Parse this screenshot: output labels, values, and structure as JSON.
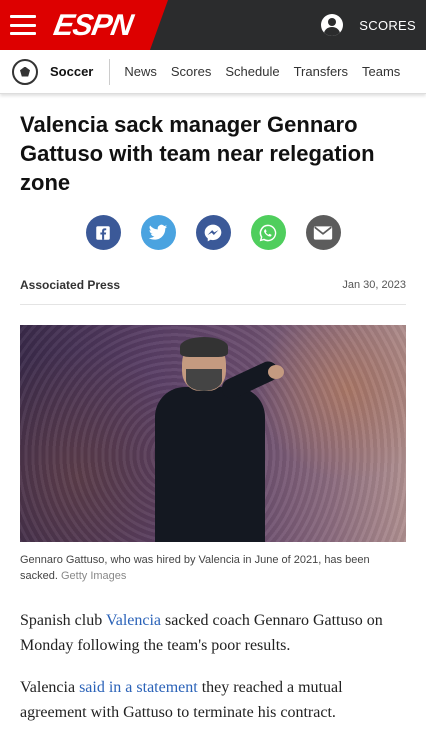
{
  "header": {
    "brand": "ESPN",
    "scores_label": "SCORES"
  },
  "subnav": {
    "sport": "Soccer",
    "items": [
      "News",
      "Scores",
      "Schedule",
      "Transfers",
      "Teams"
    ]
  },
  "article": {
    "title": "Valencia sack manager Gennaro Gattuso with team near relegation zone",
    "share_icons": [
      "facebook-icon",
      "twitter-icon",
      "messenger-icon",
      "whatsapp-icon",
      "email-icon"
    ],
    "author": "Associated Press",
    "date": "Jan 30, 2023",
    "caption": "Gennaro Gattuso, who was hired by Valencia in June of 2021, has been sacked.",
    "credit": "Getty Images",
    "p1": {
      "pre": "Spanish club ",
      "link": "Valencia",
      "post": " sacked coach Gennaro Gattuso on Monday following the team's poor results."
    },
    "p2": {
      "pre": "Valencia ",
      "link": "said in a statement",
      "post": " they reached a mutual agreement with Gattuso to terminate his contract."
    }
  },
  "colors": {
    "espn_red": "#dd0000",
    "link_blue": "#2a62b8",
    "header_dark": "#2b2c2d"
  }
}
